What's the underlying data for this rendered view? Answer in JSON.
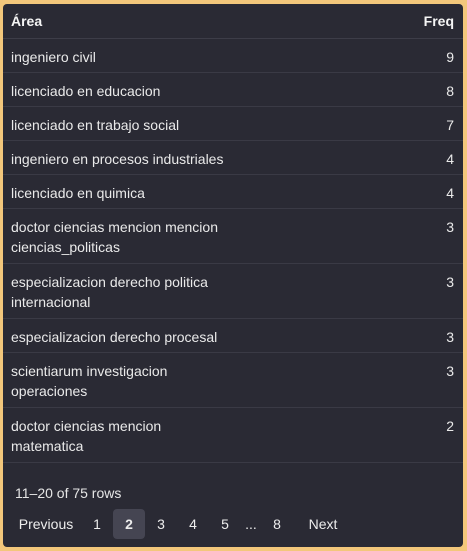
{
  "table": {
    "headers": {
      "area": "Área",
      "freq": "Freq"
    },
    "rows": [
      {
        "area": "ingeniero civil",
        "freq": "9"
      },
      {
        "area": "licenciado en educacion",
        "freq": "8"
      },
      {
        "area": "licenciado en trabajo social",
        "freq": "7"
      },
      {
        "area": "ingeniero en procesos industriales",
        "freq": "4"
      },
      {
        "area": "licenciado en quimica",
        "freq": "4"
      },
      {
        "area": "doctor ciencias mencion mencion ciencias_politicas",
        "freq": "3"
      },
      {
        "area": "especializacion derecho politica internacional",
        "freq": "3"
      },
      {
        "area": "especializacion derecho procesal",
        "freq": "3"
      },
      {
        "area": "scientiarum investigacion operaciones",
        "freq": "3"
      },
      {
        "area": "doctor ciencias mencion matematica",
        "freq": "2"
      }
    ]
  },
  "footer": {
    "row_count": "11–20 of 75 rows"
  },
  "pagination": {
    "previous": "Previous",
    "pages": [
      "1",
      "2",
      "3",
      "4",
      "5"
    ],
    "ellipsis": "...",
    "last": "8",
    "next": "Next",
    "current": "2"
  }
}
